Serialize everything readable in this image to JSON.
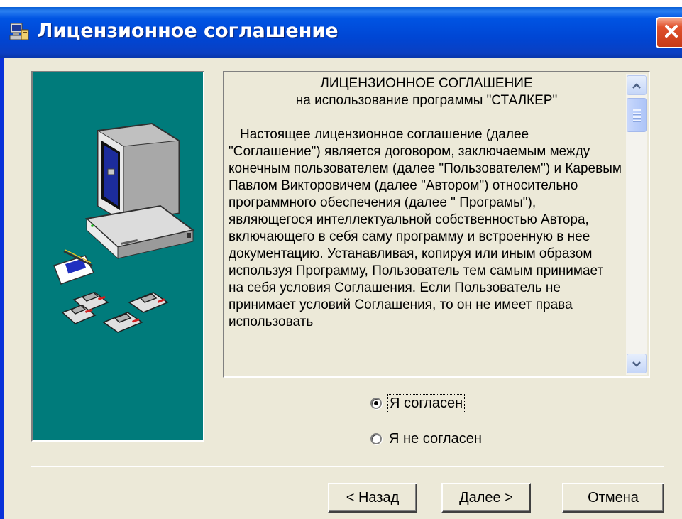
{
  "window": {
    "title": "Лицензионное соглашение",
    "colors": {
      "titlebar": "#0054e3",
      "client": "#ece9d8",
      "art_bg": "#007b7b",
      "close": "#e0522d"
    }
  },
  "license": {
    "heading": "ЛИЦЕНЗИОННОЕ СОГЛАШЕНИЕ",
    "subheading": "на использование программы \"СТАЛКЕР\"",
    "body": "Настоящее лицензионное соглашение (далее \"Соглашение\") является договором, заключаемым между конечным пользователем (далее \"Пользователем\") и Каревым Павлом Викторовичем (далее \"Автором\") относительно программного обеспечения (далее \" Програмы\"), являющегося интеллектуальной собственностью Автора, включающего в себя саму программу и встроенную в нее документацию. Устанавливая, копируя или иным образом используя Программу, Пользователь тем самым принимает на себя условия Соглашения. Если Пользователь не принимает условий Соглашения, то он не имеет права использовать"
  },
  "options": {
    "agree": {
      "label": "Я согласен",
      "checked": true
    },
    "disagree": {
      "label": "Я не согласен",
      "checked": false
    }
  },
  "buttons": {
    "back": "< Назад",
    "next": "Далее >",
    "cancel": "Отмена"
  },
  "icons": {
    "title": "installer-icon",
    "close": "close-icon",
    "scroll_up": "chevron-up-icon",
    "scroll_down": "chevron-down-icon"
  }
}
